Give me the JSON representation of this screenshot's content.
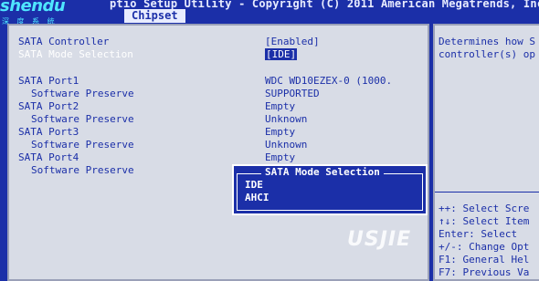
{
  "header": {
    "title": "ptio Setup Utility - Copyright (C) 2011 American Megatrends, Inc.",
    "active_tab": "Chipset"
  },
  "watermark": {
    "top_logo": "shendu",
    "top_sub": "深 度 系 统",
    "bottom_logo": "USJIE"
  },
  "settings": {
    "sata_controller": {
      "label": "SATA Controller",
      "value": "[Enabled]"
    },
    "sata_mode": {
      "label": "SATA Mode Selection",
      "value": "[IDE]"
    },
    "port1": {
      "label": "SATA Port1",
      "value": "WDC WD10EZEX-0 (1000."
    },
    "port1_sp": {
      "label": "Software Preserve",
      "value": "SUPPORTED"
    },
    "port2": {
      "label": "SATA Port2",
      "value": "Empty"
    },
    "port2_sp": {
      "label": "Software Preserve",
      "value": "Unknown"
    },
    "port3": {
      "label": "SATA Port3",
      "value": "Empty"
    },
    "port3_sp": {
      "label": "Software Preserve",
      "value": "Unknown"
    },
    "port4": {
      "label": "SATA Port4",
      "value": "Empty"
    },
    "port4_sp": {
      "label": "Software Preserve",
      "value": ""
    }
  },
  "help": {
    "line1": "Determines how S",
    "line2": "controller(s) op"
  },
  "keys": {
    "k1": "++: Select Scre",
    "k2": "↑↓: Select Item",
    "k3": "Enter: Select",
    "k4": "+/-: Change Opt",
    "k5": "F1: General Hel",
    "k6": "F7: Previous Va"
  },
  "popup": {
    "title": "SATA Mode Selection",
    "options": [
      "IDE",
      "AHCI"
    ]
  }
}
